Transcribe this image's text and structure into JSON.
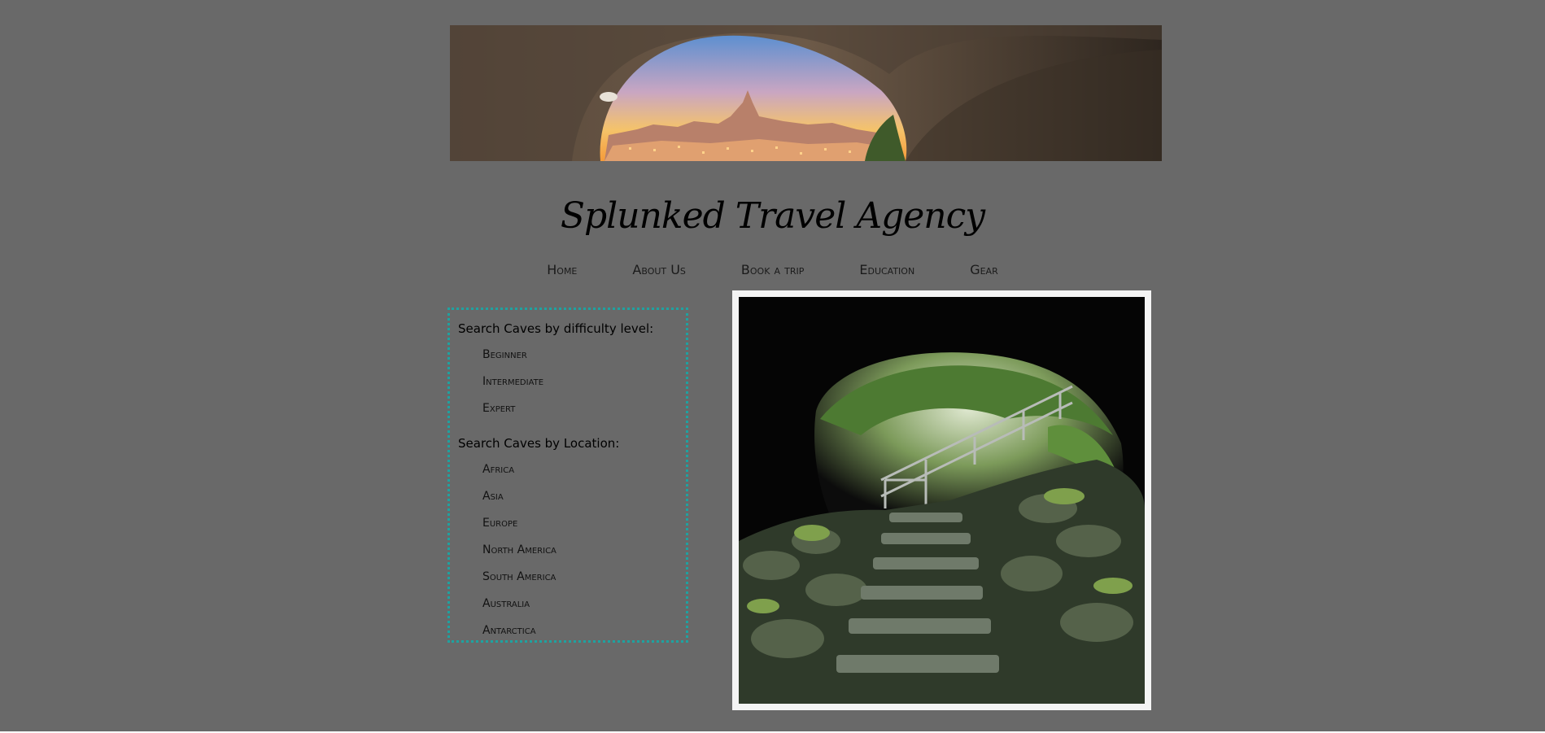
{
  "site": {
    "title": "Splunked Travel Agency"
  },
  "nav": {
    "items": [
      {
        "label": "Home"
      },
      {
        "label": "About Us"
      },
      {
        "label": "Book a trip"
      },
      {
        "label": "Education"
      },
      {
        "label": "Gear"
      }
    ]
  },
  "sidebar": {
    "difficulty_heading": "Search Caves by difficulty level:",
    "difficulty_items": [
      {
        "label": "Beginner"
      },
      {
        "label": "Intermediate"
      },
      {
        "label": "Expert"
      }
    ],
    "location_heading": "Search Caves by Location:",
    "location_items": [
      {
        "label": "Africa"
      },
      {
        "label": "Asia"
      },
      {
        "label": "Europe"
      },
      {
        "label": "North America"
      },
      {
        "label": "South America"
      },
      {
        "label": "Australia"
      },
      {
        "label": "Antarctica"
      }
    ]
  },
  "colors": {
    "page_background": "#696969",
    "sidebar_border": "#1fa2a0",
    "photo_frame": "#f4f4f4"
  }
}
